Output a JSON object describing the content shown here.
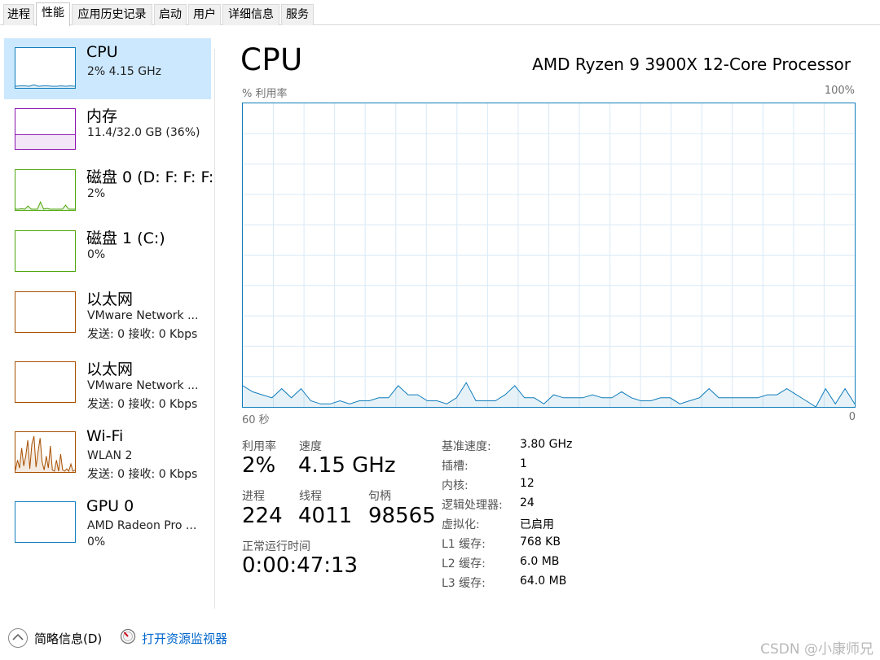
{
  "tabs": [
    {
      "label": "进程",
      "active": false
    },
    {
      "label": "性能",
      "active": true
    },
    {
      "label": "应用历史记录",
      "active": false
    },
    {
      "label": "启动",
      "active": false
    },
    {
      "label": "用户",
      "active": false
    },
    {
      "label": "详细信息",
      "active": false
    },
    {
      "label": "服务",
      "active": false
    }
  ],
  "sidebar": {
    "items": [
      {
        "name": "CPU",
        "sub1": "2% 4.15 GHz",
        "sub2": "",
        "color": "#117dbb",
        "selected": true,
        "history": [
          96,
          95,
          95,
          96,
          92,
          96,
          95,
          95,
          96,
          96,
          95,
          96,
          95,
          96
        ]
      },
      {
        "name": "内存",
        "sub1": "11.4/32.0 GB (36%)",
        "sub2": "",
        "color": "#8b12ae",
        "selected": false,
        "usage": 0.36
      },
      {
        "name": "磁盘 0 (D: F: F: F:",
        "sub1": "2%",
        "sub2": "",
        "color": "#4da60c",
        "selected": false,
        "history": [
          98,
          98,
          97,
          98,
          90,
          98,
          98,
          98,
          80,
          98,
          96,
          98,
          98,
          98,
          98,
          98,
          88,
          98,
          98,
          98
        ]
      },
      {
        "name": "磁盘 1 (C:)",
        "sub1": "0%",
        "sub2": "",
        "color": "#4da60c",
        "selected": false
      },
      {
        "name": "以太网",
        "sub1": "VMware Network ...",
        "sub2": "发送: 0 接收: 0 Kbps",
        "color": "#a74f01",
        "selected": false
      },
      {
        "name": "以太网",
        "sub1": "VMware Network ...",
        "sub2": "发送: 0 接收: 0 Kbps",
        "color": "#a74f01",
        "selected": false
      },
      {
        "name": "Wi-Fi",
        "sub1": "WLAN 2",
        "sub2": "发送: 0 接收: 0 Kbps",
        "color": "#a74f01",
        "selected": false,
        "history": [
          95,
          70,
          90,
          40,
          85,
          60,
          20,
          92,
          30,
          10,
          88,
          50,
          15,
          75,
          95,
          60,
          90,
          35,
          95,
          98,
          70,
          98,
          55,
          95,
          98,
          92,
          98,
          80,
          98,
          95
        ]
      },
      {
        "name": "GPU 0",
        "sub1": "AMD Radeon Pro ...",
        "sub2": "0%",
        "color": "#117dbb",
        "selected": false
      }
    ]
  },
  "main": {
    "title": "CPU",
    "processor": "AMD Ryzen 9 3900X 12-Core Processor",
    "axis_top_left": "% 利用率",
    "axis_top_right": "100%",
    "axis_bottom_left": "60 秒",
    "axis_bottom_right": "0",
    "graph_color": "#117dbb",
    "utilization_history": [
      7,
      5,
      4,
      3,
      6,
      3,
      6,
      2,
      1,
      1,
      2,
      1,
      2,
      2,
      3,
      3,
      7,
      4,
      4,
      2,
      2,
      1,
      3,
      8,
      2,
      2,
      2,
      4,
      7,
      3,
      3,
      1,
      4,
      3,
      3,
      3,
      4,
      3,
      3,
      5,
      3,
      2,
      2,
      3,
      3,
      1,
      2,
      3,
      6,
      3,
      3,
      3,
      3,
      3,
      4,
      4,
      6,
      4,
      2,
      0,
      6,
      1,
      6,
      1
    ]
  },
  "stats": {
    "util_label": "利用率",
    "util_value": "2%",
    "speed_label": "速度",
    "speed_value": "4.15 GHz",
    "proc_label": "进程",
    "proc_value": "224",
    "thread_label": "线程",
    "thread_value": "4011",
    "handle_label": "句柄",
    "handle_value": "98565",
    "uptime_label": "正常运行时间",
    "uptime_value": "0:00:47:13"
  },
  "info": [
    {
      "label": "基准速度:",
      "value": "3.80 GHz"
    },
    {
      "label": "插槽:",
      "value": "1"
    },
    {
      "label": "内核:",
      "value": "12"
    },
    {
      "label": "逻辑处理器:",
      "value": "24"
    },
    {
      "label": "虚拟化:",
      "value": "已启用"
    },
    {
      "label": "L1 缓存:",
      "value": "768 KB"
    },
    {
      "label": "L2 缓存:",
      "value": "6.0 MB"
    },
    {
      "label": "L3 缓存:",
      "value": "64.0 MB"
    }
  ],
  "footer": {
    "summary": "简略信息(D)",
    "monitor_link": "打开资源监视器",
    "watermark": "CSDN @小康师兄"
  }
}
